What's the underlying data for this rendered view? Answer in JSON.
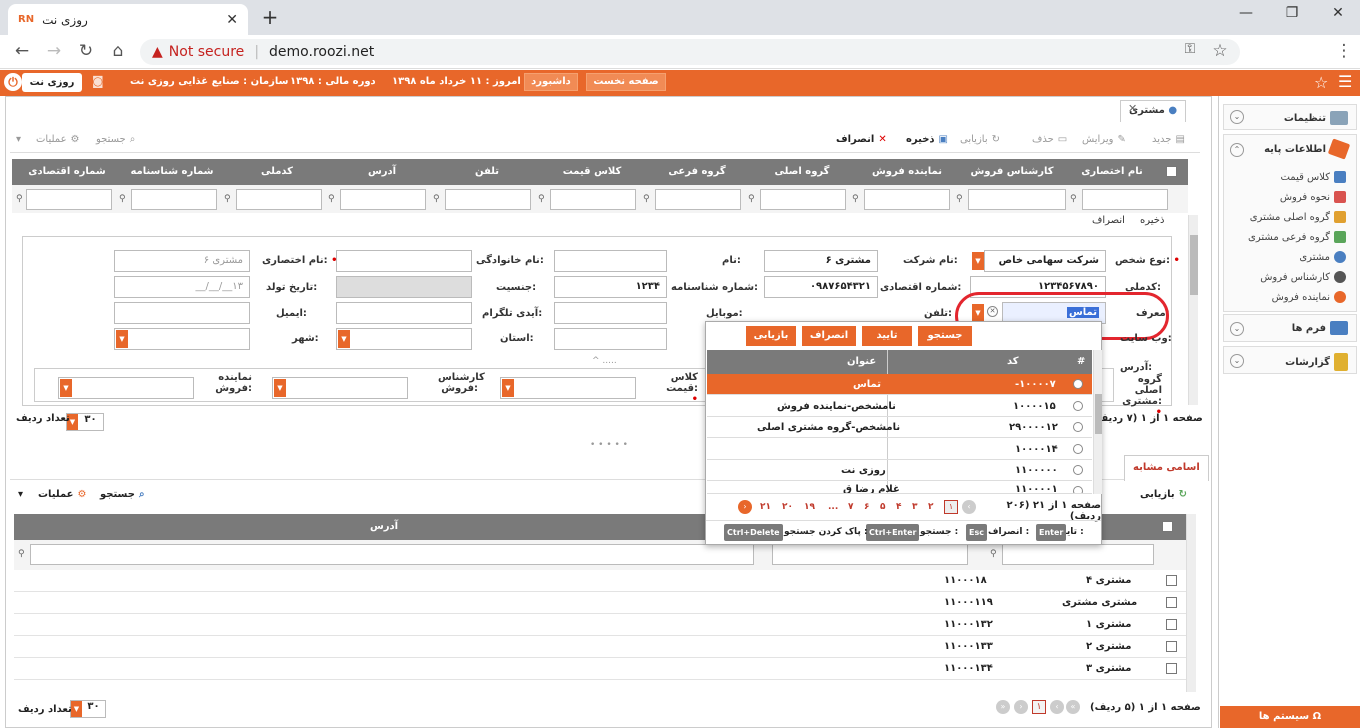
{
  "browser": {
    "tab_title": "روزی نت",
    "tab_favicon": "RN",
    "not_secure": "Not secure",
    "url": "demo.roozi.net"
  },
  "header": {
    "brand": "روزی نت",
    "organization": "سازمان : صنایع غذایی روزی نت",
    "fiscal_year": "دوره مالی : ۱۳۹۸",
    "today": "امروز : ۱۱ خرداد ماه ۱۳۹۸",
    "dashboard": "داشبورد",
    "home": "صفحه نخست"
  },
  "sidebar": {
    "settings": "تنظیمات",
    "base_info": "اطلاعات پایه",
    "sub_items": [
      "کلاس قیمت",
      "نحوه فروش",
      "گروه اصلی مشتری",
      "گروه فرعی مشتری",
      "مشتری",
      "کارشناس فروش",
      "نماینده فروش"
    ],
    "forms": "فرم ها",
    "reports": "گزارشات",
    "system": "سیستم ها"
  },
  "page_tab": "مشتری",
  "toolbar": {
    "new": "جدید",
    "edit": "ویرایش",
    "delete": "حذف",
    "refresh": "بازیابی",
    "save": "ذخیره",
    "cancel": "انصراف",
    "search": "جستجو",
    "operations": "عملیات"
  },
  "grid_columns": [
    "نام اختصاری",
    "کارشناس فروش",
    "نماینده فروش",
    "گروه اصلی",
    "گروه فرعی",
    "کلاس قیمت",
    "تلفن",
    "آدرس",
    "کدملی",
    "شماره شناسنامه",
    "شماره اقتصادی"
  ],
  "form": {
    "save": "ذخیره",
    "cancel": "انصراف",
    "person_type_label": "نوع شخص:",
    "person_type_value": "شرکت سهامی خاص",
    "company_name_label": "نام شرکت:",
    "company_name_value": "مشتری ۶",
    "first_name_label": "نام:",
    "last_name_label": "نام خانوادگی:",
    "short_name_label": "نام اختصاری:",
    "short_name_placeholder": "مشتری ۶",
    "national_code_label": "کدملی:",
    "national_code_value": "۱۲۳۴۵۶۷۸۹۰",
    "economic_no_label": "شماره اقتصادی:",
    "economic_no_value": "۰۹۸۷۶۵۴۳۲۱",
    "id_no_label": "شماره شناسنامه:",
    "id_no_value": "۱۲۳۴",
    "gender_label": "جنسیت:",
    "birth_label": "تاریخ تولد:",
    "birth_placeholder": "۱۳__/__/__",
    "referrer_label": "معرف:",
    "referrer_value": "تماس",
    "phone_label": "تلفن:",
    "mobile_label": "موبایل:",
    "telegram_label": "آیدی تلگرام:",
    "email_label": "ایمیل:",
    "website_label": "وب سایت:",
    "province_label": "استان:",
    "city_label": "شهر:",
    "address_label": "آدرس:",
    "main_group_label": "گروه اصلی مشتری:",
    "price_class_label": "کلاس قیمت:",
    "sales_expert_label": "کارشناس فروش:",
    "sales_rep_label": "نماینده فروش:"
  },
  "top_pager": {
    "page_info": "صفحه ۱ از ۱ (۷ ردیف)",
    "rows_label": "تعداد ردیف",
    "rows_value": "۳۰"
  },
  "popup": {
    "search": "جستجو",
    "confirm": "تایید",
    "cancel": "انصراف",
    "refresh": "بازیابی",
    "col_hash": "#",
    "col_code": "کد",
    "col_title": "عنوان",
    "rows": [
      {
        "code": "-۱۰۰۰۰۷",
        "title": "تماس"
      },
      {
        "code": "۱۰۰۰۰۱۵",
        "title": "نامشخص-نماینده فروش"
      },
      {
        "code": "۲۹۰۰۰۰۱۲",
        "title": "نامشخص-گروه مشتری اصلی"
      },
      {
        "code": "۱۰۰۰۰۱۴",
        "title": ""
      },
      {
        "code": "۱۱۰۰۰۰۰",
        "title": "روزی نت"
      },
      {
        "code": "۱۱۰۰۰۰۱",
        "title": "غلام رضا ق"
      }
    ],
    "page_info": "صفحه ۱ از ۲۱ (۲۰۶ ردیف)",
    "pages": [
      "۱",
      "۲",
      "۳",
      "۴",
      "۵",
      "۶",
      "۷",
      "...",
      "۱۹",
      "۲۰",
      "۲۱"
    ],
    "hint_enter_key": "Enter",
    "hint_enter": "تایید :",
    "hint_esc_key": "Esc",
    "hint_esc": "انصراف :",
    "hint_search_key": "Ctrl+Enter",
    "hint_search": "جستجو :",
    "hint_clear_key": "Ctrl+Delete",
    "hint_clear": "پاک کردن جستجو :"
  },
  "bottom": {
    "tab": "اسامی مشابه",
    "refresh": "بازیابی",
    "search": "جستجو",
    "operations": "عملیات",
    "col_address": "آدرس",
    "rows": [
      {
        "name": "مشتری ۴",
        "code": "۱۱۰۰۰۱۸"
      },
      {
        "name": "مشتری مشتری",
        "code": "۱۱۰۰۰۱۱۹"
      },
      {
        "name": "مشتری ۱",
        "code": "۱۱۰۰۰۱۳۲"
      },
      {
        "name": "مشتری ۲",
        "code": "۱۱۰۰۰۱۳۳"
      },
      {
        "name": "مشتری ۳",
        "code": "۱۱۰۰۰۱۳۴"
      }
    ],
    "page_info": "صفحه ۱ از ۱ (۵ ردیف)",
    "rows_label": "تعداد ردیف",
    "rows_value": "۳۰",
    "current_page": "۱"
  },
  "colors": {
    "accent": "#e8672a",
    "grid_header": "#7a7a7a",
    "highlight": "#e3262e"
  }
}
